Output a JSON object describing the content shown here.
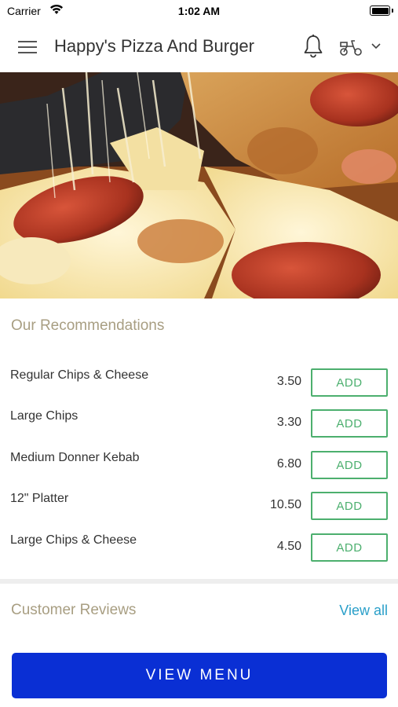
{
  "status_bar": {
    "carrier": "Carrier",
    "time": "1:02 AM"
  },
  "header": {
    "title": "Happy's Pizza And Burger",
    "menu_icon": "hamburger-menu-icon",
    "notification_icon": "bell-icon",
    "delivery_icon": "scooter-icon",
    "dropdown_icon": "chevron-down-icon"
  },
  "hero": {
    "image": "pepperoni-pizza-photo"
  },
  "recommendations": {
    "title": "Our Recommendations",
    "items": [
      {
        "name": "Regular Chips & Cheese",
        "price": "3.50",
        "button": "ADD"
      },
      {
        "name": "Large Chips",
        "price": "3.30",
        "button": "ADD"
      },
      {
        "name": "Medium Donner Kebab",
        "price": "6.80",
        "button": "ADD"
      },
      {
        "name": "12\" Platter",
        "price": "10.50",
        "button": "ADD"
      },
      {
        "name": "Large Chips & Cheese",
        "price": "4.50",
        "button": "ADD"
      }
    ]
  },
  "reviews": {
    "title": "Customer Reviews",
    "view_all": "View all"
  },
  "footer": {
    "view_menu": "VIEW MENU"
  },
  "colors": {
    "accent_blue": "#0a2fd4",
    "add_green": "#4caf6e",
    "section_title": "#a89e82",
    "link_blue": "#2a9fc9"
  }
}
